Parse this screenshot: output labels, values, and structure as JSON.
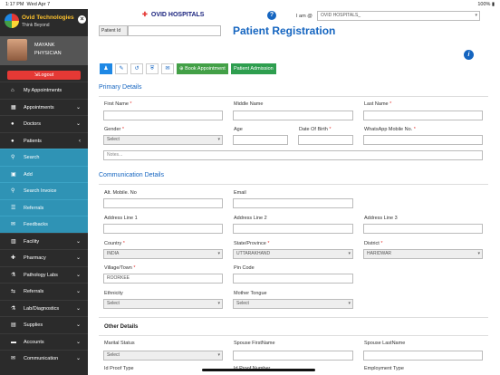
{
  "status": {
    "time": "1:17 PM",
    "date": "Wed Apr 7",
    "battery": "100%"
  },
  "brand": {
    "name": "Ovid Technologies",
    "tagline": "Think Beyond"
  },
  "profile": {
    "name": "MAYANK",
    "role": "PHYSICIAN",
    "logout": "Logout"
  },
  "sidebar": {
    "items": [
      {
        "label": "My Appointments",
        "icon": "home-icon"
      },
      {
        "label": "Appointments",
        "icon": "calendar-icon"
      },
      {
        "label": "Doctors",
        "icon": "user-md-icon"
      },
      {
        "label": "Patients",
        "icon": "patients-icon"
      }
    ],
    "patient_sub": [
      {
        "label": "Search",
        "icon": "search-icon"
      },
      {
        "label": "Add",
        "icon": "plus-icon"
      },
      {
        "label": "Search Invoice",
        "icon": "search-icon"
      },
      {
        "label": "Referrals",
        "icon": "list-icon"
      },
      {
        "label": "Feedbacks",
        "icon": "chat-icon"
      }
    ],
    "more": [
      {
        "label": "Facility",
        "icon": "building-icon"
      },
      {
        "label": "Pharmacy",
        "icon": "pill-icon"
      },
      {
        "label": "Pathology Labs",
        "icon": "flask-icon"
      },
      {
        "label": "Referrals",
        "icon": "share-icon"
      },
      {
        "label": "Lab/Diagnostics",
        "icon": "lab-icon"
      },
      {
        "label": "Supplies",
        "icon": "box-icon"
      },
      {
        "label": "Accounts",
        "icon": "money-icon"
      },
      {
        "label": "Communication",
        "icon": "mail-icon"
      }
    ]
  },
  "header": {
    "hospital": "OVID HOSPITALS",
    "iam": "I am @",
    "iam_value": "OVID HOSPITALS_"
  },
  "form": {
    "patient_id_label": "Patient Id",
    "title": "Patient Registration",
    "book_appointment": "Book Appointment",
    "patient_admission": "Patient Admission",
    "primary_details": "Primary Details",
    "communication_details": "Communication Details",
    "other_details": "Other Details",
    "first_name": "First Name",
    "middle_name": "Middle Name",
    "last_name": "Last Name",
    "gender": "Gender",
    "gender_value": "Select",
    "age": "Age",
    "dob": "Date Of Birth",
    "whatsapp": "WhatsApp Mobile No.",
    "notes_placeholder": "Notes...",
    "alt_mobile": "Alt. Mobile. No",
    "email": "Email",
    "address1": "Address Line 1",
    "address2": "Address Line 2",
    "address3": "Address Line 3",
    "country": "Country",
    "country_value": "INDIA",
    "state": "State/Province",
    "state_value": "UTTARAKHAND",
    "district": "District",
    "district_value": "HARIDWAR",
    "village": "Village/Town",
    "village_value": "ROORKEE",
    "pincode": "Pin Code",
    "ethnicity": "Ethnicity",
    "ethnicity_value": "Select",
    "mother_tongue": "Mother Tongue",
    "mother_tongue_value": "Select",
    "marital_status": "Marital Status",
    "marital_value": "Select",
    "spouse_first": "Spouse FirstName",
    "spouse_last": "Spouse LastName",
    "id_proof": "Id Proof Type",
    "id_proof_number": "Id Proof Number",
    "employment": "Employment Type",
    "required_mark": "*"
  }
}
